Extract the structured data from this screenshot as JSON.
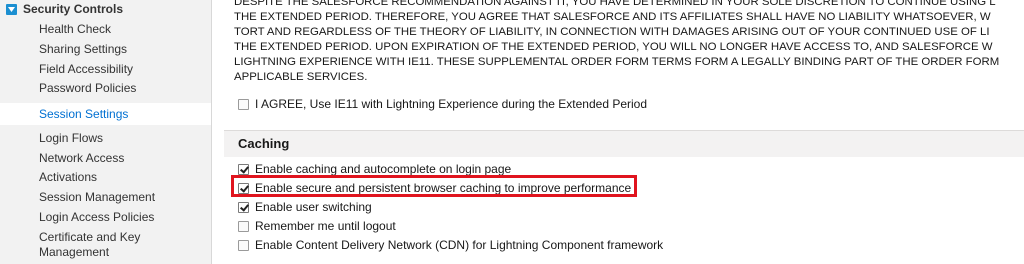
{
  "sidebar": {
    "header": "Security Controls",
    "items": [
      {
        "label": "Health Check"
      },
      {
        "label": "Sharing Settings"
      },
      {
        "label": "Field Accessibility"
      },
      {
        "label": "Password Policies"
      },
      {
        "label": "Session Settings",
        "active": true
      },
      {
        "label": "Login Flows"
      },
      {
        "label": "Network Access"
      },
      {
        "label": "Activations"
      },
      {
        "label": "Session Management"
      },
      {
        "label": "Login Access Policies"
      },
      {
        "label": "Certificate and Key"
      },
      {
        "label": "Management"
      }
    ]
  },
  "disclaimer": {
    "lines": [
      "DESPITE THE SALESFORCE RECOMMENDATION AGAINST IT, YOU HAVE DETERMINED IN YOUR SOLE DISCRETION TO CONTINUE USING L",
      "THE EXTENDED PERIOD. THEREFORE, YOU AGREE THAT SALESFORCE AND ITS AFFILIATES SHALL HAVE NO LIABILITY WHATSOEVER, W",
      "TORT AND REGARDLESS OF THE THEORY OF LIABILITY, IN CONNECTION WITH DAMAGES ARISING OUT OF YOUR CONTINUED USE OF LI",
      "THE EXTENDED PERIOD. UPON EXPIRATION OF THE EXTENDED PERIOD, YOU WILL NO LONGER HAVE ACCESS TO, AND SALESFORCE W",
      "LIGHTNING EXPERIENCE WITH IE11. THESE SUPPLEMENTAL ORDER FORM TERMS FORM A LEGALLY BINDING PART OF THE ORDER FORM",
      "APPLICABLE SERVICES."
    ]
  },
  "agree": {
    "label": "I AGREE, Use IE11 with Lightning Experience during the Extended Period",
    "checked": false
  },
  "caching": {
    "title": "Caching",
    "options": [
      {
        "label": "Enable caching and autocomplete on login page",
        "checked": true
      },
      {
        "label": "Enable secure and persistent browser caching to improve performance",
        "checked": true,
        "highlighted": true
      },
      {
        "label": "Enable user switching",
        "checked": true
      },
      {
        "label": "Remember me until logout",
        "checked": false
      },
      {
        "label": "Enable Content Delivery Network (CDN) for Lightning Component framework",
        "checked": false
      }
    ]
  },
  "colors": {
    "accent": "#0070d2",
    "highlight": "#e0141e",
    "sidebar_bg": "#f2f2f2"
  }
}
